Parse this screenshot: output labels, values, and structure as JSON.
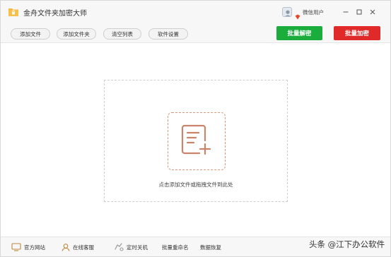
{
  "app": {
    "title": "金舟文件夹加密大师",
    "user_name": "微信用户"
  },
  "toolbar": {
    "add_file": "添加文件",
    "add_folder": "添加文件夹",
    "clear_list": "清空列表",
    "settings": "软件设置",
    "batch_decrypt": "批量解密",
    "batch_encrypt": "批量加密"
  },
  "drop": {
    "hint": "点击添加文件或拖拽文件到此处"
  },
  "statusbar": {
    "website": "官方网站",
    "service": "在线客服",
    "shutdown": "定时关机",
    "rename": "批量重命名",
    "recovery": "数据恢复"
  },
  "watermark": "头条 @江下办公软件",
  "colors": {
    "decrypt_green": "#1aad3c",
    "encrypt_red": "#e02a2a",
    "drop_accent": "#d6967a",
    "background": "#f7f7f7"
  },
  "icons": {
    "logo": "folder-lock-icon",
    "minimize": "minimize-icon",
    "maximize": "maximize-icon",
    "close": "close-icon",
    "add_file": "file-add-icon"
  }
}
